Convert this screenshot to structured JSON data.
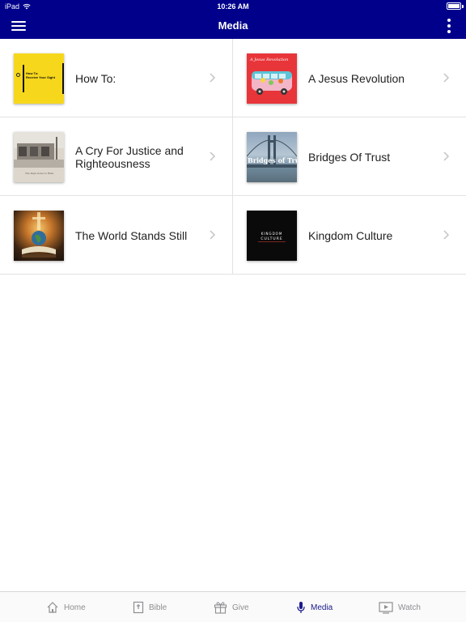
{
  "status": {
    "device": "iPad",
    "time": "10:26 AM"
  },
  "nav": {
    "title": "Media"
  },
  "items": [
    {
      "label": "How To:",
      "thumb_text": "How To:\nReceive Your Sight"
    },
    {
      "label": "A Jesus Revolution",
      "thumb_text": "A Jesus Revolution"
    },
    {
      "label": "A Cry For Justice and Righteousness",
      "thumb_text": "The Days Gone to Hide"
    },
    {
      "label": "Bridges Of Trust",
      "thumb_text": "Bridges of Trust"
    },
    {
      "label": "The World Stands Still",
      "thumb_text": ""
    },
    {
      "label": "Kingdom Culture",
      "thumb_text": "KINGDOM CULTURE"
    }
  ],
  "tabs": [
    {
      "label": "Home",
      "icon": "home-icon"
    },
    {
      "label": "Bible",
      "icon": "bible-icon"
    },
    {
      "label": "Give",
      "icon": "gift-icon"
    },
    {
      "label": "Media",
      "icon": "microphone-icon"
    },
    {
      "label": "Watch",
      "icon": "play-icon"
    }
  ],
  "colors": {
    "header": "#00008b",
    "active_tab": "#1a1a8c",
    "inactive_tab": "#8e8e93"
  }
}
